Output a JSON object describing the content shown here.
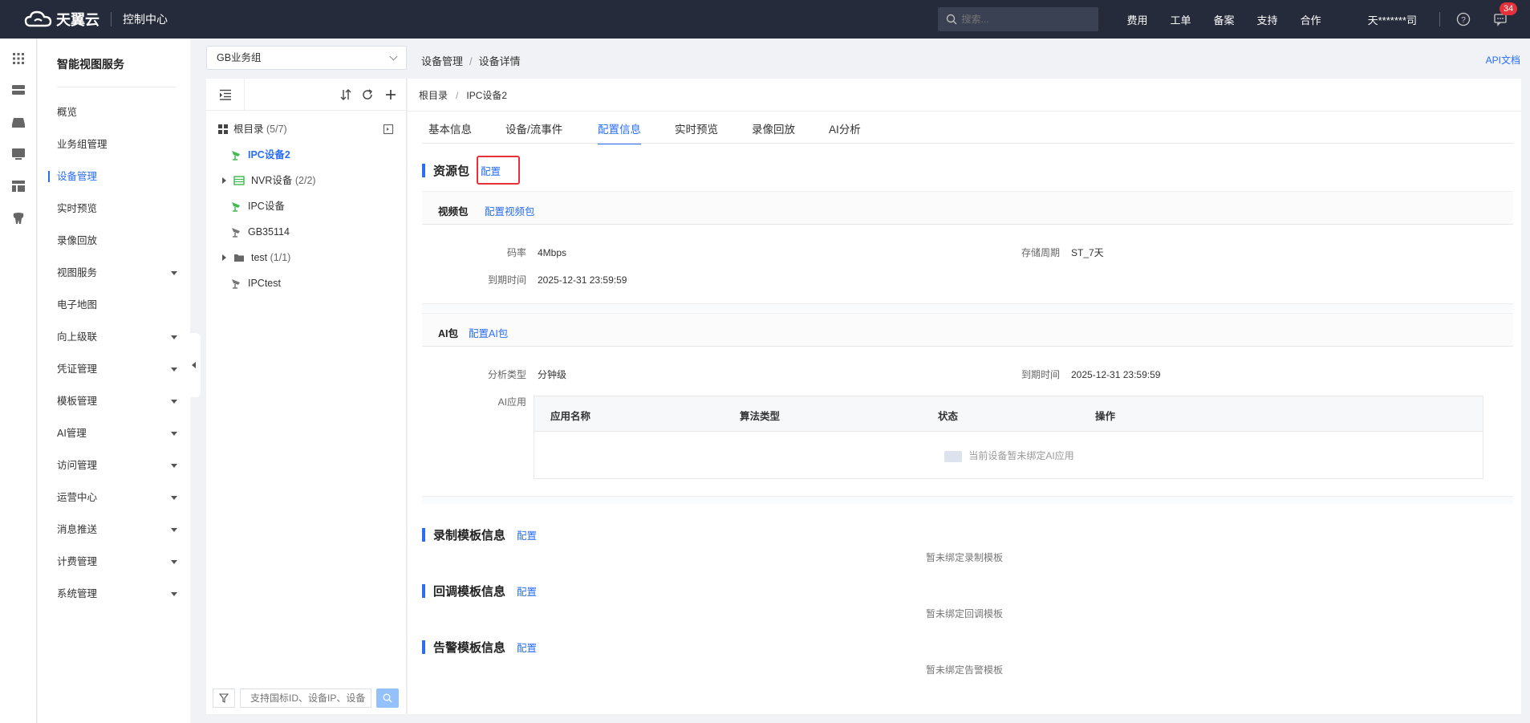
{
  "topbar": {
    "brand": "天翼云",
    "console": "控制中心",
    "search_placeholder": "搜索...",
    "nav": [
      "费用",
      "工单",
      "备案",
      "支持",
      "合作"
    ],
    "user": "天*******司",
    "notify_count": "34"
  },
  "menu": {
    "title": "智能视图服务",
    "items": [
      {
        "label": "概览",
        "caret": false
      },
      {
        "label": "业务组管理",
        "caret": false
      },
      {
        "label": "设备管理",
        "caret": false,
        "active": true
      },
      {
        "label": "实时预览",
        "caret": false
      },
      {
        "label": "录像回放",
        "caret": false
      },
      {
        "label": "视图服务",
        "caret": true
      },
      {
        "label": "电子地图",
        "caret": false
      },
      {
        "label": "向上级联",
        "caret": true
      },
      {
        "label": "凭证管理",
        "caret": true
      },
      {
        "label": "模板管理",
        "caret": true
      },
      {
        "label": "AI管理",
        "caret": true
      },
      {
        "label": "访问管理",
        "caret": true
      },
      {
        "label": "运营中心",
        "caret": true
      },
      {
        "label": "消息推送",
        "caret": true
      },
      {
        "label": "计费管理",
        "caret": true
      },
      {
        "label": "系统管理",
        "caret": true
      }
    ]
  },
  "tree": {
    "group_select": "GB业务组",
    "root_label": "根目录",
    "root_count": "(5/7)",
    "nodes": [
      {
        "label": "IPC设备2",
        "count": "",
        "selected": true
      },
      {
        "label": "NVR设备",
        "count": "(2/2)"
      },
      {
        "label": "IPC设备",
        "count": ""
      },
      {
        "label": "GB35114",
        "count": ""
      },
      {
        "label": "test",
        "count": "(1/1)"
      },
      {
        "label": "IPCtest",
        "count": ""
      }
    ],
    "search_placeholder": "支持国标ID、设备IP、设备"
  },
  "breadcrumb": {
    "parent": "设备管理",
    "current": "设备详情"
  },
  "api_doc": "API文档",
  "sub_crumb": {
    "root": "根目录",
    "current": "IPC设备2"
  },
  "tabs": [
    "基本信息",
    "设备/流事件",
    "配置信息",
    "实时预览",
    "录像回放",
    "AI分析"
  ],
  "resource": {
    "title": "资源包",
    "config": "配置",
    "video": {
      "title": "视频包",
      "config_link": "配置视频包",
      "bitrate_label": "码率",
      "bitrate": "4Mbps",
      "storage_label": "存储周期",
      "storage": "ST_7天",
      "expire_label": "到期时间",
      "expire": "2025-12-31 23:59:59"
    },
    "ai": {
      "title": "AI包",
      "config_link": "配置AI包",
      "type_label": "分析类型",
      "type": "分钟级",
      "expire_label": "到期时间",
      "expire": "2025-12-31 23:59:59",
      "apps_label": "AI应用",
      "columns": [
        "应用名称",
        "算法类型",
        "状态",
        "操作"
      ],
      "empty": "当前设备暂未绑定AI应用"
    }
  },
  "record_tpl": {
    "title": "录制模板信息",
    "config": "配置",
    "empty": "暂未绑定录制模板"
  },
  "callback_tpl": {
    "title": "回调模板信息",
    "config": "配置",
    "empty": "暂未绑定回调模板"
  },
  "alarm_tpl": {
    "title": "告警模板信息",
    "config": "配置",
    "empty": "暂未绑定告警模板"
  }
}
